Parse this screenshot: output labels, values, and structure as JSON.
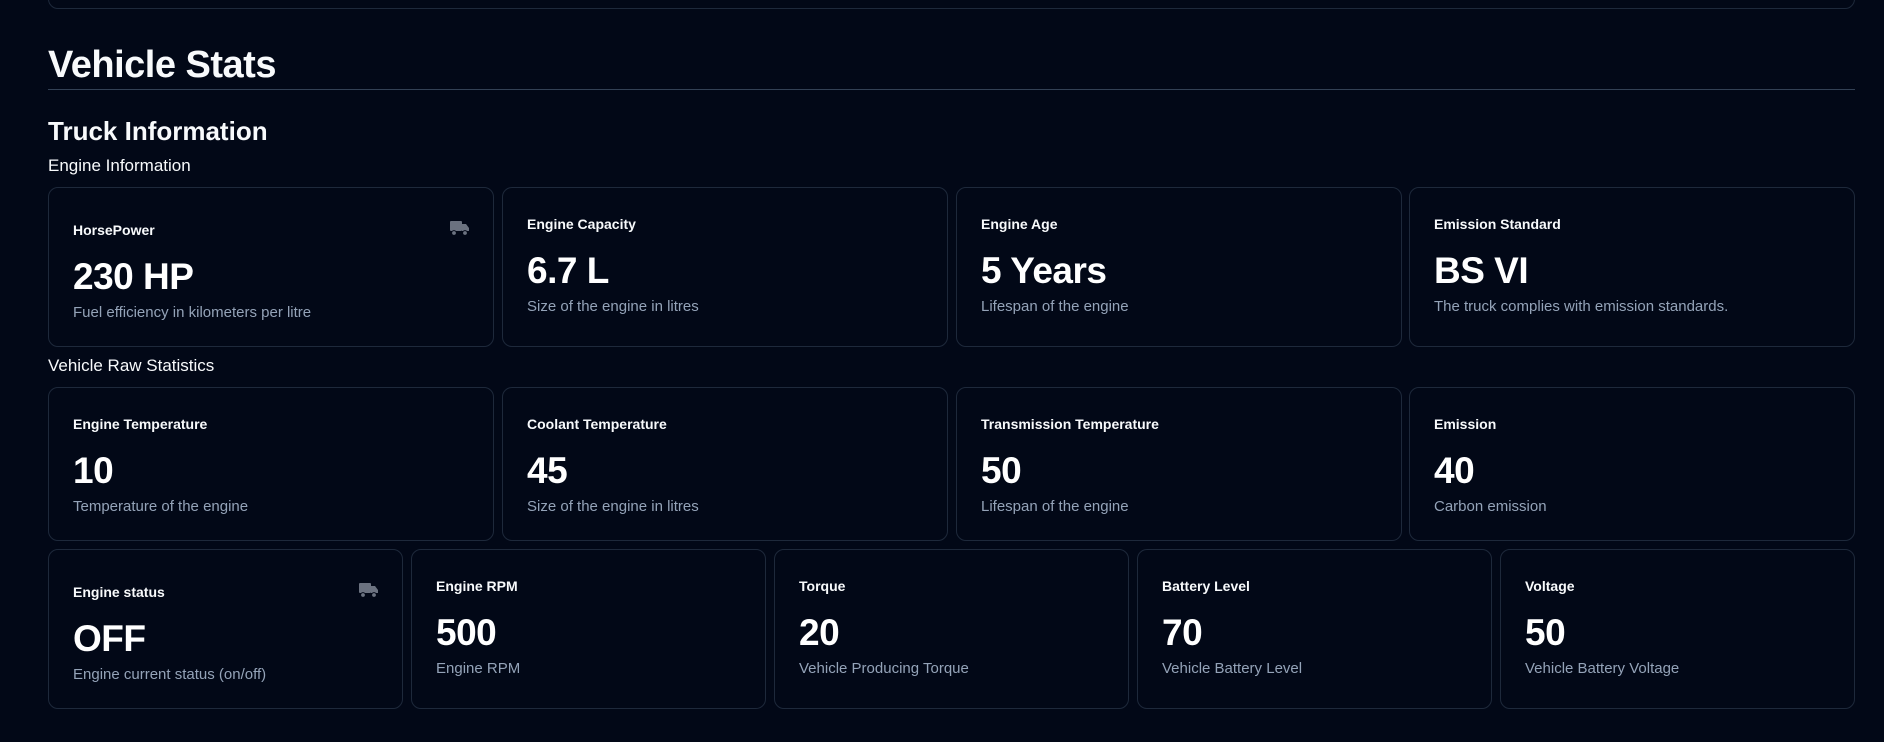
{
  "page": {
    "title": "Vehicle Stats",
    "section_title": "Truck Information"
  },
  "engine_info": {
    "heading": "Engine Information",
    "cards": [
      {
        "label": "HorsePower",
        "value": "230 HP",
        "description": "Fuel efficiency in kilometers per litre",
        "icon": "truck-icon"
      },
      {
        "label": "Engine Capacity",
        "value": "6.7 L",
        "description": "Size of the engine in litres"
      },
      {
        "label": "Engine Age",
        "value": "5 Years",
        "description": "Lifespan of the engine"
      },
      {
        "label": "Emission Standard",
        "value": "BS VI",
        "description": "The truck complies with emission standards."
      }
    ]
  },
  "raw_stats": {
    "heading": "Vehicle Raw Statistics",
    "row1": [
      {
        "label": "Engine Temperature",
        "value": "10",
        "description": "Temperature of the engine"
      },
      {
        "label": "Coolant Temperature",
        "value": "45",
        "description": "Size of the engine in litres"
      },
      {
        "label": "Transmission Temperature",
        "value": "50",
        "description": "Lifespan of the engine"
      },
      {
        "label": "Emission",
        "value": "40",
        "description": "Carbon emission"
      }
    ],
    "row2": [
      {
        "label": "Engine status",
        "value": "OFF",
        "description": "Engine current status (on/off)",
        "icon": "truck-icon"
      },
      {
        "label": "Engine RPM",
        "value": "500",
        "description": "Engine RPM"
      },
      {
        "label": "Torque",
        "value": "20",
        "description": "Vehicle Producing Torque"
      },
      {
        "label": "Battery Level",
        "value": "70",
        "description": "Vehicle Battery Level"
      },
      {
        "label": "Voltage",
        "value": "50",
        "description": "Vehicle Battery Voltage"
      }
    ]
  },
  "colors": {
    "background": "#020817",
    "card_border": "#1e293b",
    "muted_text": "#94a3b8",
    "icon": "#6b7280"
  }
}
